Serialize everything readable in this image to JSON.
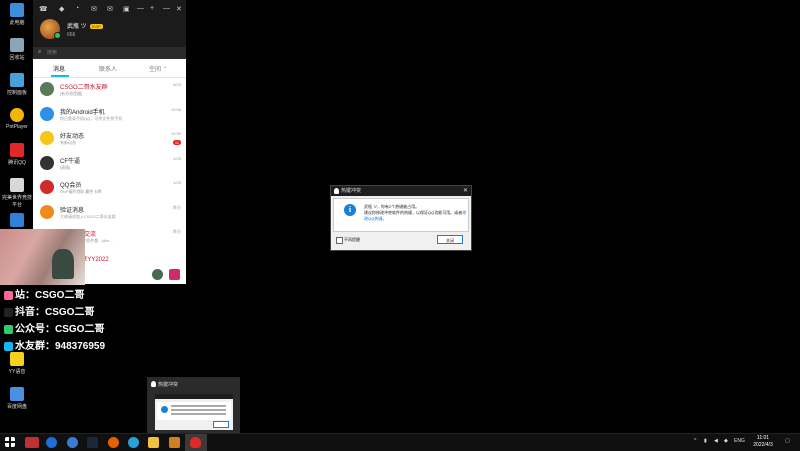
{
  "desktop": {
    "icons": [
      {
        "label": "此电脑",
        "color": "#3a8fd8"
      },
      {
        "label": "回收站",
        "color": "#8aa4b8"
      },
      {
        "label": "控制面板",
        "color": "#4aa0d8"
      },
      {
        "label": "PotPlayer",
        "color": "#f2b705"
      },
      {
        "label": "腾讯QQ",
        "color": "#e02828"
      },
      {
        "label": "完美世界竞技平台",
        "color": "#d8d8d8"
      },
      {
        "label": "",
        "color": "#2f80d8"
      },
      {
        "label": "YY语音",
        "color": "#f5d11e"
      },
      {
        "label": "百度网盘",
        "color": "#4a90e2"
      }
    ]
  },
  "qq": {
    "toolbar": [
      "☎",
      "◆",
      "◔",
      "✉",
      "✉",
      "▣",
      "—",
      "+",
      "—",
      "✕"
    ],
    "profile": {
      "name": "武瓶 ツ",
      "badge": "SVIP",
      "signature": "666"
    },
    "search": {
      "placeholder": "搜索"
    },
    "tabs": [
      "消息",
      "联系人",
      "空间"
    ],
    "conversations": [
      {
        "title": "CSGO二哥水友群",
        "subtitle": "[有消息提醒]",
        "time": "8/23",
        "count": "",
        "red": true,
        "avatar_color": "#5a7a5a"
      },
      {
        "title": "我的Android手机",
        "subtitle": "你已登录手机QQ，可传文件到手机",
        "time": "10:58",
        "count": "",
        "red": false,
        "avatar_color": "#2e8fe6"
      },
      {
        "title": "好友动态",
        "subtitle": "有新动态",
        "time": "10:59",
        "count": "11",
        "red": false,
        "avatar_color": "#f5c518"
      },
      {
        "title": "CF牛逼",
        "subtitle": "[表情]",
        "time": "2/25",
        "count": "",
        "red": false,
        "avatar_color": "#333333"
      },
      {
        "title": "QQ会员",
        "subtitle": "DNF福利领取 赢性卡牌",
        "time": "1/25",
        "count": "",
        "red": false,
        "avatar_color": "#d02a2a"
      },
      {
        "title": "验证消息",
        "subtitle": "大佬请求加入CSGO二哥水友群",
        "time": "昨天",
        "count": "",
        "red": false,
        "avatar_color": "#f08a1c"
      },
      {
        "title": "鹅博技术交流",
        "subtitle": "[群]小诗：安全软件都.. (dlm...",
        "time": "昨天",
        "count": "",
        "red": true,
        "avatar_color": "#7a5ad8"
      },
      {
        "title": "[分享]分享YY2022",
        "subtitle": "",
        "time": "",
        "count": "",
        "red": true,
        "avatar_color": "#d85a5a"
      }
    ]
  },
  "overlay": {
    "lines": [
      {
        "logo": "B",
        "text": "站：CSGO二哥",
        "logo_color": "#ff6699"
      },
      {
        "logo": "♪",
        "text": "抖音：CSGO二哥",
        "logo_color": "#222222"
      },
      {
        "logo": "◉",
        "text": "公众号：CSGO二哥",
        "logo_color": "#2ecc71"
      },
      {
        "logo": "Q",
        "text": "水友群：948376959",
        "logo_color": "#12b7f5"
      }
    ]
  },
  "dialog": {
    "title": "热键冲突",
    "message_line1": "武瓶 ツ，你有2个热键被占用。",
    "message_line2": "建议你修改冲突软件的热键，以保证QQ功能可用。或者",
    "message_link": "修改QQ热键",
    "message_end": "。",
    "checkbox_label": "不再提醒",
    "close_label": "关闭"
  },
  "preview": {
    "title": "热键冲突"
  },
  "taskbar": {
    "tray_lang": "ENG",
    "time": "11:01",
    "date": "2022/4/3"
  }
}
